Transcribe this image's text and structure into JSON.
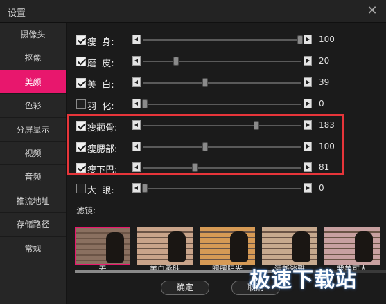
{
  "window": {
    "title": "设置",
    "close_icon": "close-icon"
  },
  "sidebar": {
    "items": [
      {
        "label": "摄像头"
      },
      {
        "label": "抠像"
      },
      {
        "label": "美颜",
        "active": true
      },
      {
        "label": "色彩"
      },
      {
        "label": "分屏显示"
      },
      {
        "label": "视频"
      },
      {
        "label": "音频"
      },
      {
        "label": "推流地址"
      },
      {
        "label": "存储路径"
      },
      {
        "label": "常规"
      }
    ],
    "active_color": "#e8176d"
  },
  "sliders": [
    {
      "label": "瘦  身:",
      "checked": true,
      "value": "100",
      "level": 1.0
    },
    {
      "label": "磨  皮:",
      "checked": true,
      "value": "20",
      "level": 0.2
    },
    {
      "label": "美  白:",
      "checked": true,
      "value": "39",
      "level": 0.39
    },
    {
      "label": "羽  化:",
      "checked": false,
      "value": "0",
      "level": 0.0
    },
    {
      "label": "瘦颧骨:",
      "checked": true,
      "value": "183",
      "level": 0.72
    },
    {
      "label": "瘦腮部:",
      "checked": true,
      "value": "100",
      "level": 0.39
    },
    {
      "label": "瘦下巴:",
      "checked": true,
      "value": "81",
      "level": 0.32
    },
    {
      "label": "大  眼:",
      "checked": false,
      "value": "0",
      "level": 0.0
    }
  ],
  "highlight_color": "#e7353a",
  "filters": {
    "label": "滤镜:",
    "items": [
      {
        "label": "无",
        "selected": true,
        "tint": "#8a7060"
      },
      {
        "label": "美白柔肤",
        "tint": "#c9a48a"
      },
      {
        "label": "暖暖阳光",
        "tint": "#d69a55"
      },
      {
        "label": "清新淡雅",
        "tint": "#c7a98e"
      },
      {
        "label": "我美可人",
        "tint": "#c8a0a0"
      }
    ]
  },
  "buttons": {
    "ok": "确定",
    "cancel": "取消"
  },
  "watermark": "极速下载站"
}
